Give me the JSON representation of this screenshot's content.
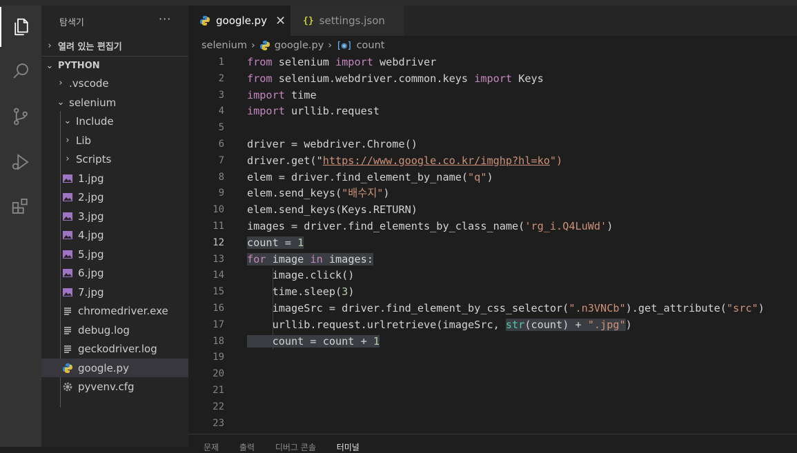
{
  "explorer": {
    "title": "탐색기",
    "more": "···",
    "open_editors_label": "열려 있는 편집기",
    "project_label": "PYTHON",
    "items": [
      {
        "label": ".vscode",
        "kind": "folder-collapsed"
      },
      {
        "label": "selenium",
        "kind": "folder-expanded"
      },
      {
        "label": "Include",
        "kind": "folder-expanded"
      },
      {
        "label": "Lib",
        "kind": "folder-collapsed"
      },
      {
        "label": "Scripts",
        "kind": "folder-collapsed"
      },
      {
        "label": "1.jpg",
        "kind": "image"
      },
      {
        "label": "2.jpg",
        "kind": "image"
      },
      {
        "label": "3.jpg",
        "kind": "image"
      },
      {
        "label": "4.jpg",
        "kind": "image"
      },
      {
        "label": "5.jpg",
        "kind": "image"
      },
      {
        "label": "6.jpg",
        "kind": "image"
      },
      {
        "label": "7.jpg",
        "kind": "image"
      },
      {
        "label": "chromedriver.exe",
        "kind": "file"
      },
      {
        "label": "debug.log",
        "kind": "file"
      },
      {
        "label": "geckodriver.log",
        "kind": "file"
      },
      {
        "label": "google.py",
        "kind": "python"
      },
      {
        "label": "pyvenv.cfg",
        "kind": "gear"
      }
    ]
  },
  "tabs": [
    {
      "label": "google.py",
      "close": "✕"
    },
    {
      "label": "settings.json"
    }
  ],
  "breadcrumb": [
    "selenium",
    "google.py",
    "count"
  ],
  "editor": {
    "active_line": 12,
    "line_numbers": [
      "1",
      "2",
      "3",
      "4",
      "5",
      "6",
      "7",
      "8",
      "9",
      "10",
      "11",
      "12",
      "13",
      "14",
      "15",
      "16",
      "17",
      "18",
      "19",
      "20",
      "21",
      "22",
      "23"
    ],
    "tok": {
      "from": "from",
      "import": "import",
      "for": "for",
      "in": "in",
      "selenium": " selenium ",
      "webdriver": " webdriver",
      "sel_keys_mod": " selenium.webdriver.common.keys ",
      "keys": " Keys",
      "time": " time",
      "urllib": " urllib.request",
      "l6": "driver = webdriver.Chrome()",
      "l7a": "driver.get(\"",
      "l7url": "https://www.google.co.kr/imghp?hl=ko",
      "l7b": "\")",
      "l8a": "elem = driver.find_element_by_name(",
      "l8s": "\"q\"",
      "l8b": ")",
      "l9a": "elem.send_keys(",
      "l9s": "\"배수지\"",
      "l9b": ")",
      "l10": "elem.send_keys(Keys.RETURN)",
      "l11a": "images = driver.find_elements_by_class_name(",
      "l11s": "'rg_i.Q4LuWd'",
      "l11b": ")",
      "l12a": "count = ",
      "l12n": "1",
      "l13a": " image ",
      "l13b": " images:",
      "l14": "    image.click()",
      "l15a": "    time.sleep(",
      "l15n": "3",
      "l15b": ")",
      "l16a": "    imageSrc = driver.find_element_by_css_selector(",
      "l16s": "\".n3VNCb\"",
      "l16b": ").get_attribute(",
      "l16s2": "\"src\"",
      "l16c": ")",
      "l17a": "    urllib.request.urlretrieve(imageSrc, ",
      "l17bi": "str",
      "l17b": "(count) + ",
      "l17s": "\".jpg\"",
      "l17c": ")",
      "l18a": "    count = count + ",
      "l18n": "1"
    }
  },
  "panel": {
    "tabs": [
      "문제",
      "출력",
      "디버그 콘솔",
      "터미널"
    ]
  },
  "colors": {
    "keyword": "#c586c0",
    "string": "#ce9178",
    "number": "#b5cea8",
    "builtin": "#4ec9b0",
    "python_icon": "#3b89c8",
    "image_icon": "#a074c4",
    "settings_icon": "#cbcb41"
  }
}
